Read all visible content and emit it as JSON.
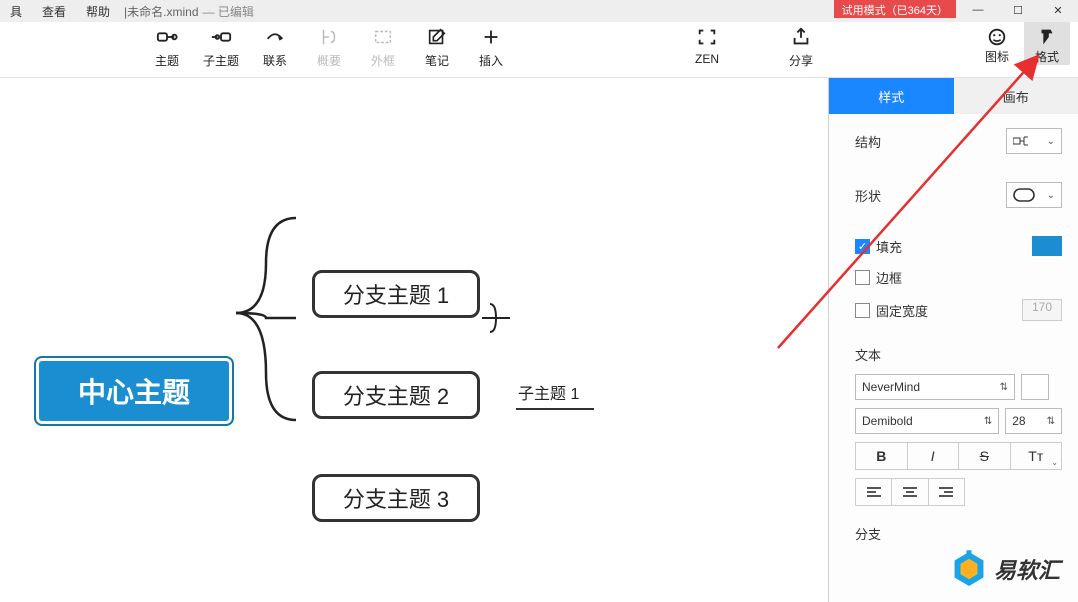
{
  "titlebar": {
    "menus": [
      "具",
      "查看",
      "帮助"
    ],
    "filename": "未命名.xmind",
    "edited": "— 已编辑",
    "trial": "试用模式（已364天）"
  },
  "toolbar": {
    "items": [
      {
        "label": "主题",
        "icon": "topic"
      },
      {
        "label": "子主题",
        "icon": "subtopic"
      },
      {
        "label": "联系",
        "icon": "link"
      },
      {
        "label": "概要",
        "icon": "summary",
        "disabled": true
      },
      {
        "label": "外框",
        "icon": "frame",
        "disabled": true
      },
      {
        "label": "笔记",
        "icon": "note"
      },
      {
        "label": "插入",
        "icon": "insert"
      }
    ],
    "right": [
      {
        "label": "ZEN",
        "icon": "zen"
      },
      {
        "label": "分享",
        "icon": "share"
      }
    ],
    "panel_switch": [
      {
        "label": "图标",
        "icon": "smile"
      },
      {
        "label": "格式",
        "icon": "format",
        "active": true
      }
    ]
  },
  "canvas": {
    "central": "中心主题",
    "branches": [
      "分支主题 1",
      "分支主题 2",
      "分支主题 3"
    ],
    "subtopic": "子主题 1"
  },
  "panel": {
    "tabs": [
      "样式",
      "画布"
    ],
    "structure_label": "结构",
    "shape_label": "形状",
    "fill_label": "填充",
    "border_label": "边框",
    "fixed_width_label": "固定宽度",
    "fixed_width_value": "170",
    "text_label": "文本",
    "font_family": "NeverMind",
    "font_weight": "Demibold",
    "font_size": "28",
    "format_btns": {
      "bold": "B",
      "italic": "I",
      "strike": "S",
      "case": "Tᴛ"
    },
    "branch_section": "分支"
  },
  "watermark": "易软汇"
}
